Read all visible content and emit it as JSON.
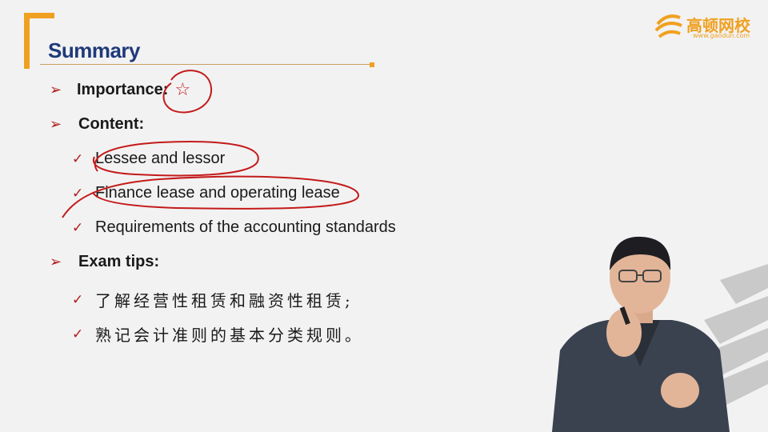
{
  "slide": {
    "title": "Summary",
    "importance_label": "Importance:",
    "importance_star": "☆",
    "content_label": "Content:",
    "content_items": [
      "Lessee and lessor",
      "Finance lease and operating lease",
      "Requirements of the accounting standards"
    ],
    "exam_label": "Exam tips:",
    "exam_items": [
      "了解经营性租赁和融资性租赁;",
      "熟记会计准则的基本分类规则。"
    ]
  },
  "logo": {
    "name": "高顿网校",
    "url": "www.gaodun.com"
  },
  "glyphs": {
    "arrow": "➢",
    "check": "✓"
  },
  "colors": {
    "accent": "#f0a020",
    "title": "#1f3a7a",
    "bullet": "#b11a1a",
    "annotation": "#c41a1a"
  }
}
